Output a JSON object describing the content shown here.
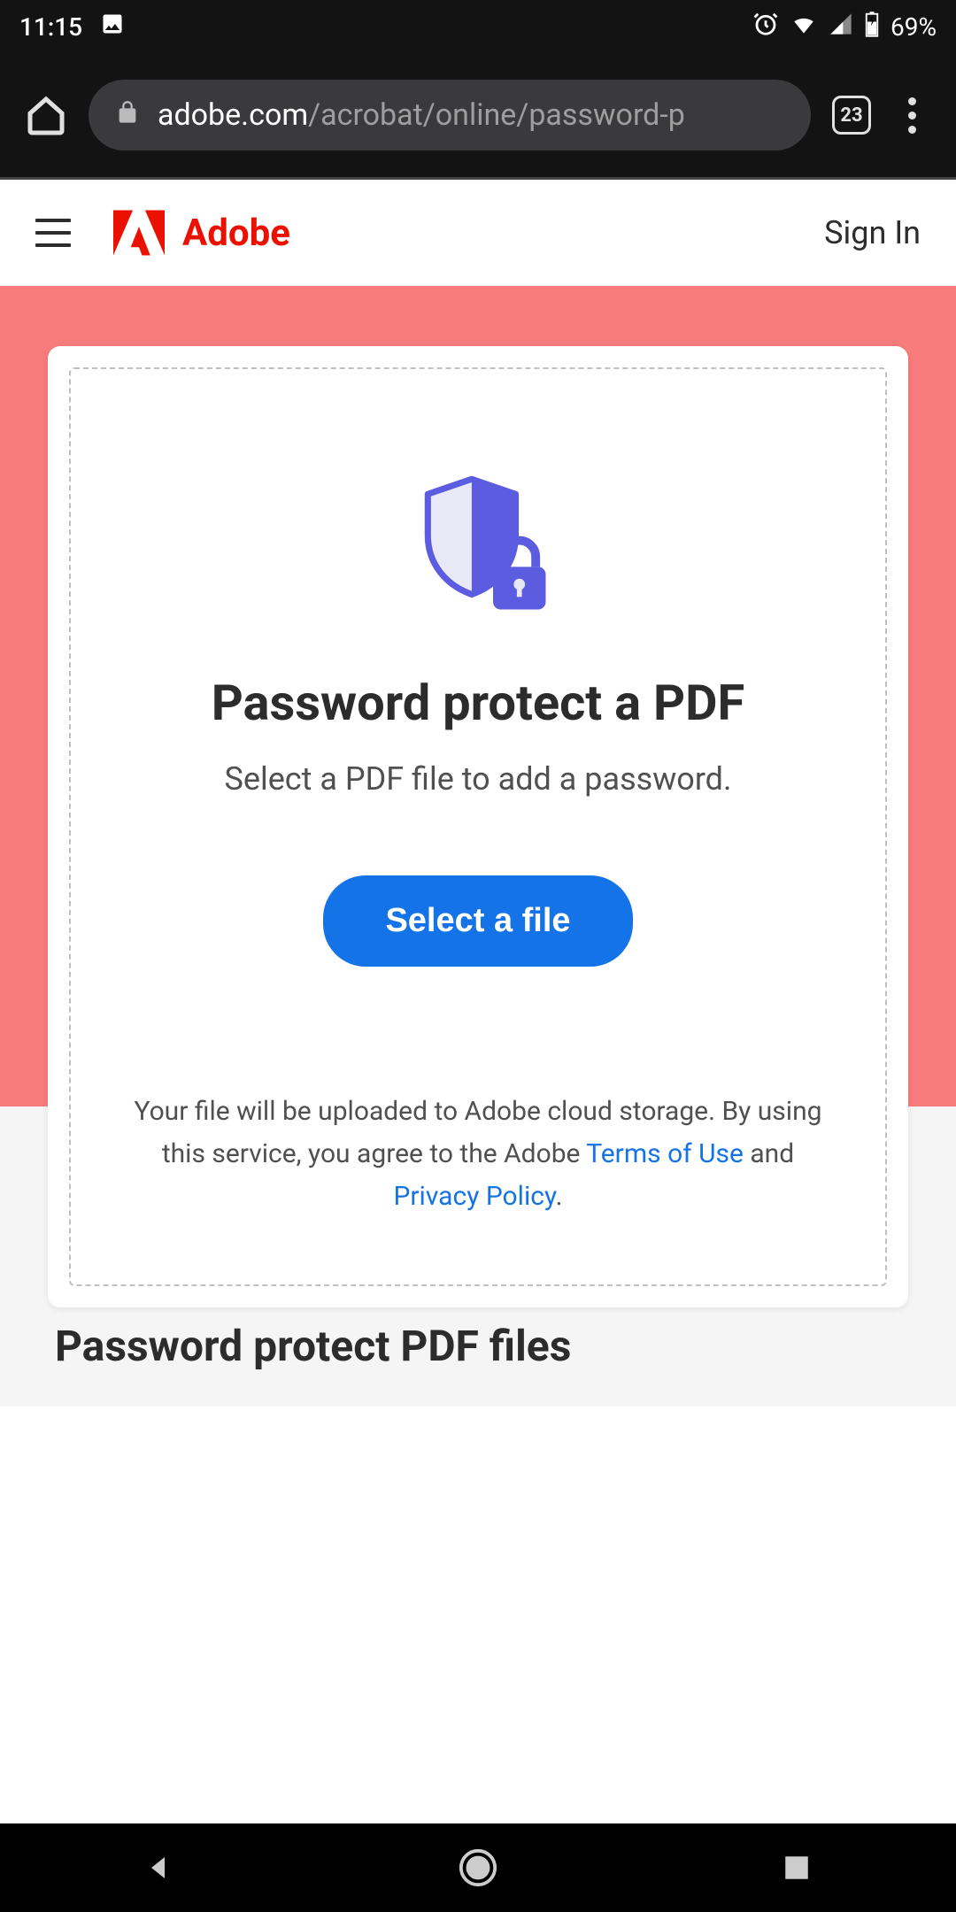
{
  "status_bar": {
    "time": "11:15",
    "battery": "69%"
  },
  "browser": {
    "url_domain": "adobe.com",
    "url_path": "/acrobat/online/password-p",
    "tab_count": "23"
  },
  "header": {
    "brand": "Adobe",
    "sign_in": "Sign In"
  },
  "card": {
    "title": "Password protect a PDF",
    "subtitle": "Select a PDF file to add a password.",
    "button": "Select a file",
    "terms_prefix": "Your file will be uploaded to Adobe cloud storage.  By using this service, you agree to the Adobe ",
    "terms_link": "Terms of Use",
    "terms_mid": " and ",
    "privacy_link": "Privacy Policy",
    "terms_suffix": "."
  },
  "below": {
    "title": "Password protect PDF files"
  }
}
